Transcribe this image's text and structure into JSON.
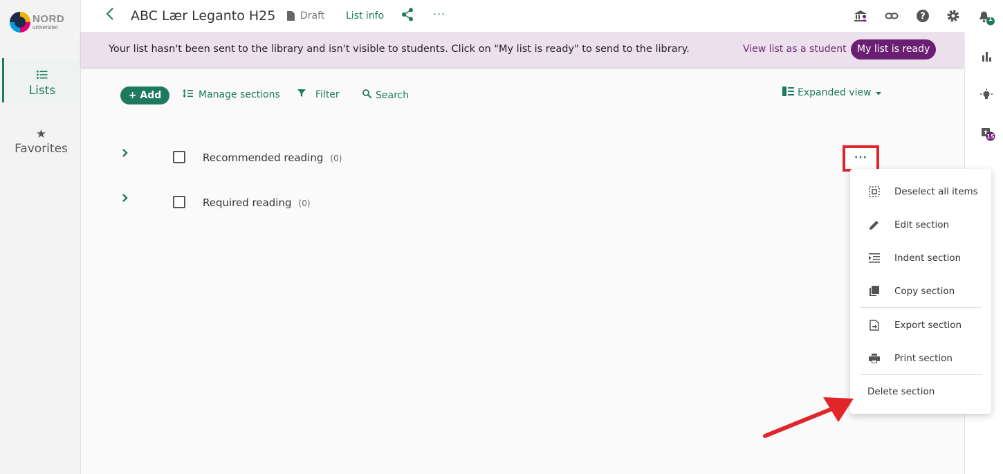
{
  "brand": {
    "top": "NORD",
    "bottom": "universitet"
  },
  "nav": [
    {
      "label": "Lists",
      "icon": "list-icon"
    },
    {
      "label": "Favorites",
      "icon": "star-icon"
    }
  ],
  "header": {
    "title": "ABC Lær Leganto H25",
    "status": "Draft",
    "list_info": "List info",
    "more": "···",
    "notification_count": "1"
  },
  "banner": {
    "message": "Your list hasn't been sent to the library and isn't visible to students. Click on \"My list is ready\" to send to the library.",
    "view_as_student": "View list as a student",
    "ready_button": "My list is ready"
  },
  "rightrail": {
    "badge_count": "15"
  },
  "toolbar": {
    "add": "+ Add",
    "manage_sections": "Manage sections",
    "filter": "Filter",
    "search": "Search",
    "view": "Expanded view"
  },
  "sections": [
    {
      "name": "Recommended reading",
      "count": "(0)"
    },
    {
      "name": "Required reading",
      "count": "(0)"
    }
  ],
  "section_more": "···",
  "menu": [
    {
      "label": "Deselect all items",
      "icon": "deselect-icon"
    },
    {
      "label": "Edit section",
      "icon": "pencil-icon"
    },
    {
      "label": "Indent section",
      "icon": "indent-icon"
    },
    {
      "label": "Copy section",
      "icon": "copy-icon"
    },
    {
      "label": "Export section",
      "icon": "export-icon"
    },
    {
      "label": "Print section",
      "icon": "print-icon"
    },
    {
      "label": "Delete section",
      "icon": ""
    }
  ],
  "colors": {
    "accent": "#1e7a5f",
    "banner_bg": "#ece0ec",
    "ready_button": "#6b1f72",
    "highlight": "#e0262a"
  }
}
